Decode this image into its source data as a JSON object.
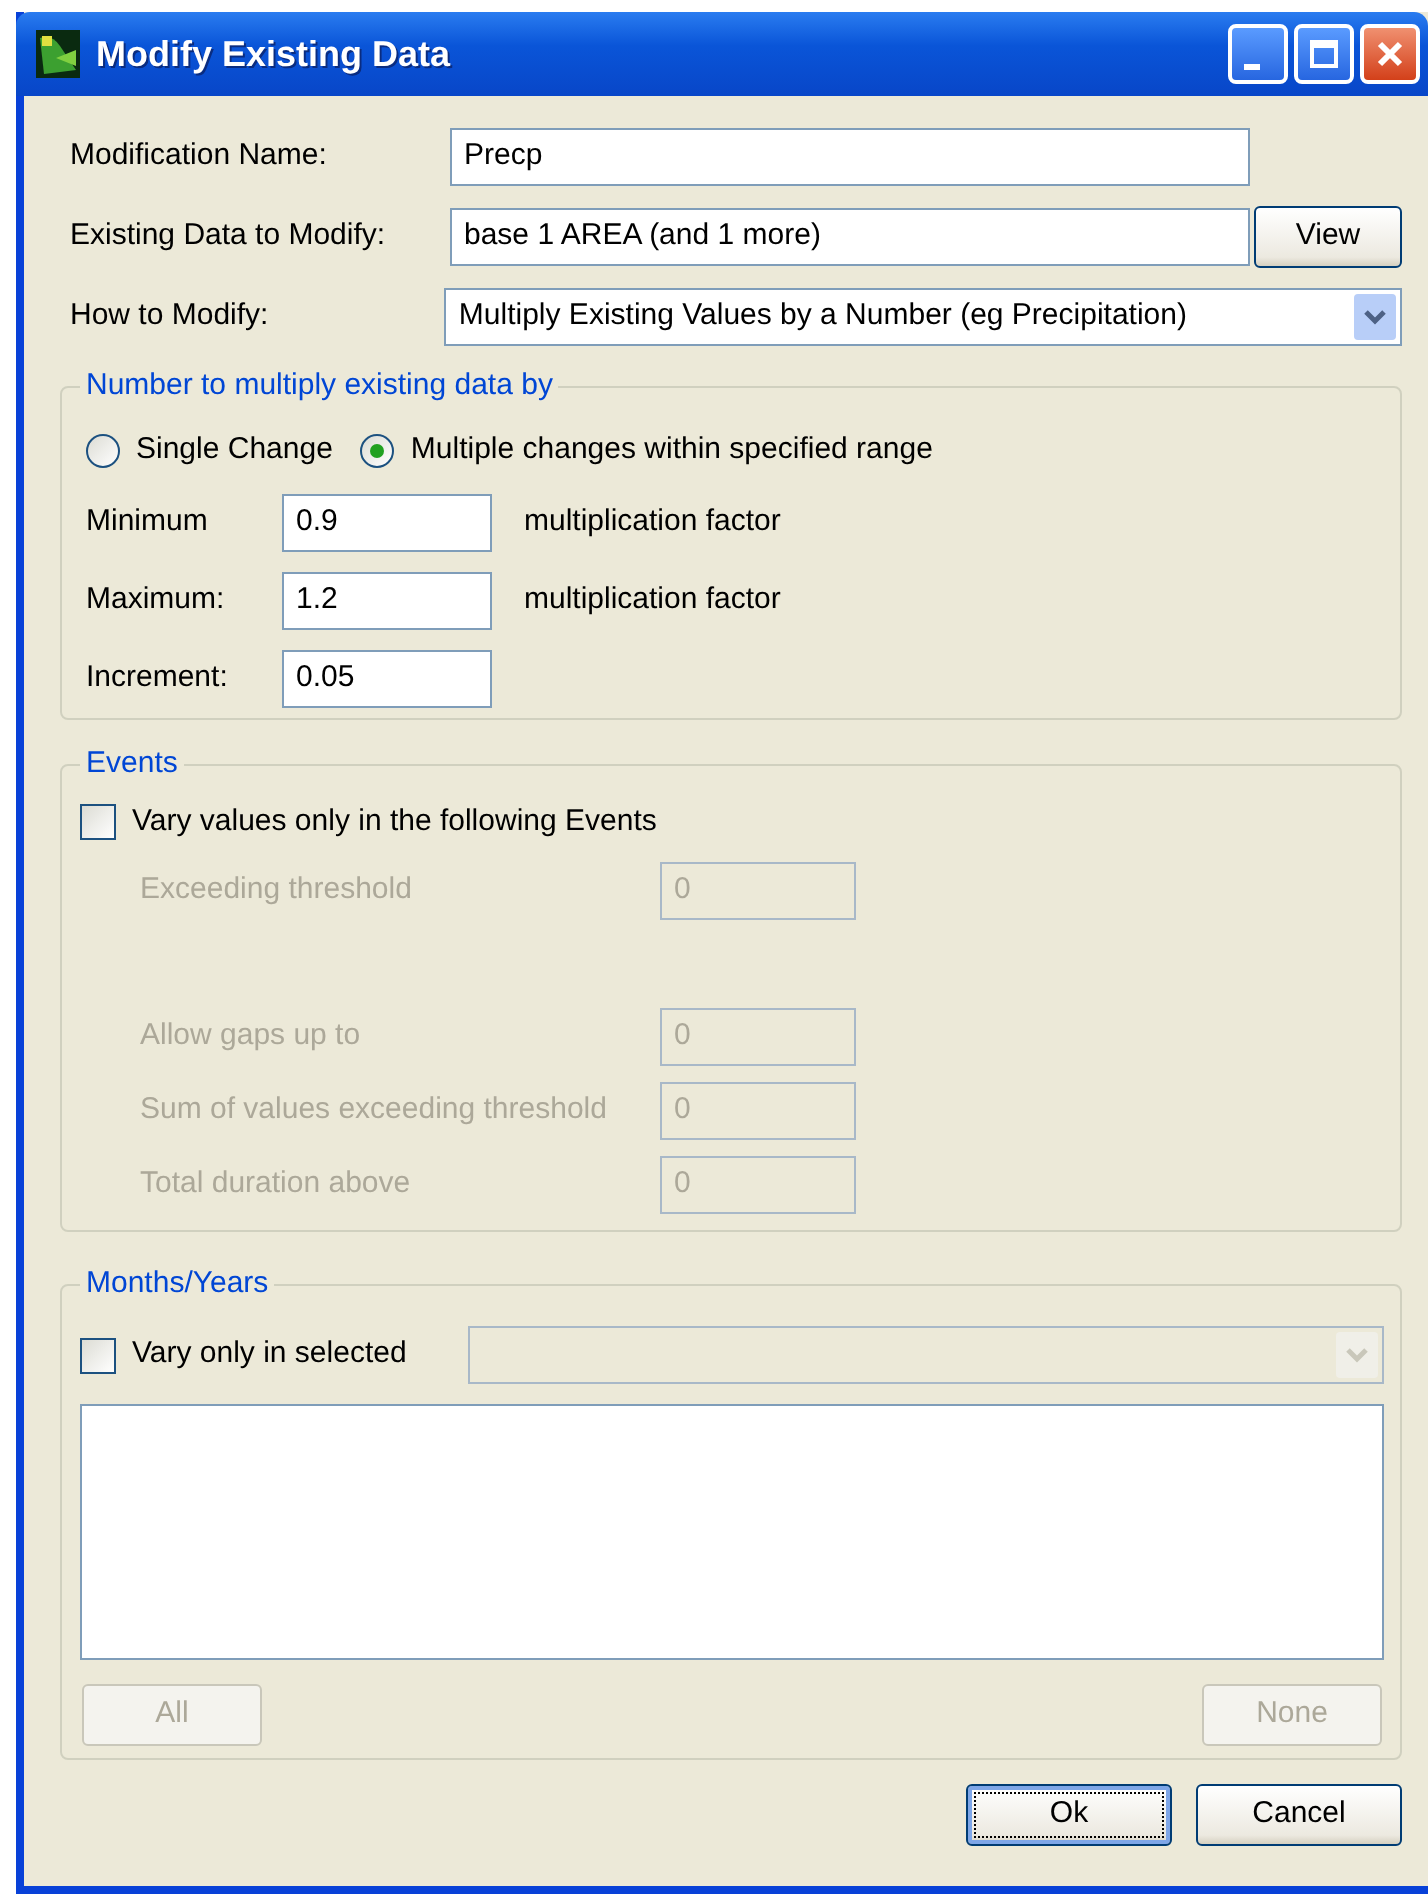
{
  "window": {
    "title": "Modify Existing Data"
  },
  "fields": [
    {
      "kind": "text",
      "label": "Modification Name:",
      "value": "Precp"
    },
    {
      "kind": "text",
      "label": "Existing Data to Modify:",
      "value": "base 1 AREA (and 1 more)",
      "button": "View"
    },
    {
      "kind": "select",
      "label": "How to Modify:",
      "value": "Multiply Existing Values by a Number (eg Precipitation)"
    }
  ],
  "multiply_group": {
    "legend": "Number to multiply existing data by",
    "options": [
      {
        "label": "Single Change",
        "selected": false
      },
      {
        "label": "Multiple changes within specified range",
        "selected": true
      }
    ],
    "rows": [
      {
        "label": "Minimum",
        "value": "0.9",
        "unit": "multiplication factor"
      },
      {
        "label": "Maximum:",
        "value": "1.2",
        "unit": "multiplication factor"
      },
      {
        "label": "Increment:",
        "value": "0.05"
      }
    ]
  },
  "events_group": {
    "legend": "Events",
    "checkbox": {
      "label": "Vary values only in the following Events",
      "checked": false
    },
    "rows": [
      {
        "label": "Exceeding threshold",
        "value": "0",
        "disabled": true
      },
      {
        "label": "Allow gaps up to",
        "value": "0",
        "disabled": true
      },
      {
        "label": "Sum of values exceeding threshold",
        "value": "0",
        "disabled": true
      },
      {
        "label": "Total duration above",
        "value": "0",
        "disabled": true
      }
    ]
  },
  "months_group": {
    "legend": "Months/Years",
    "checkbox": {
      "label": "Vary only in selected",
      "checked": false
    },
    "combo_disabled": true,
    "buttons": [
      {
        "label": "All",
        "disabled": true
      },
      {
        "label": "None",
        "disabled": true
      }
    ]
  },
  "buttons": [
    {
      "label": "Ok",
      "default": true
    },
    {
      "label": "Cancel",
      "default": false
    }
  ]
}
